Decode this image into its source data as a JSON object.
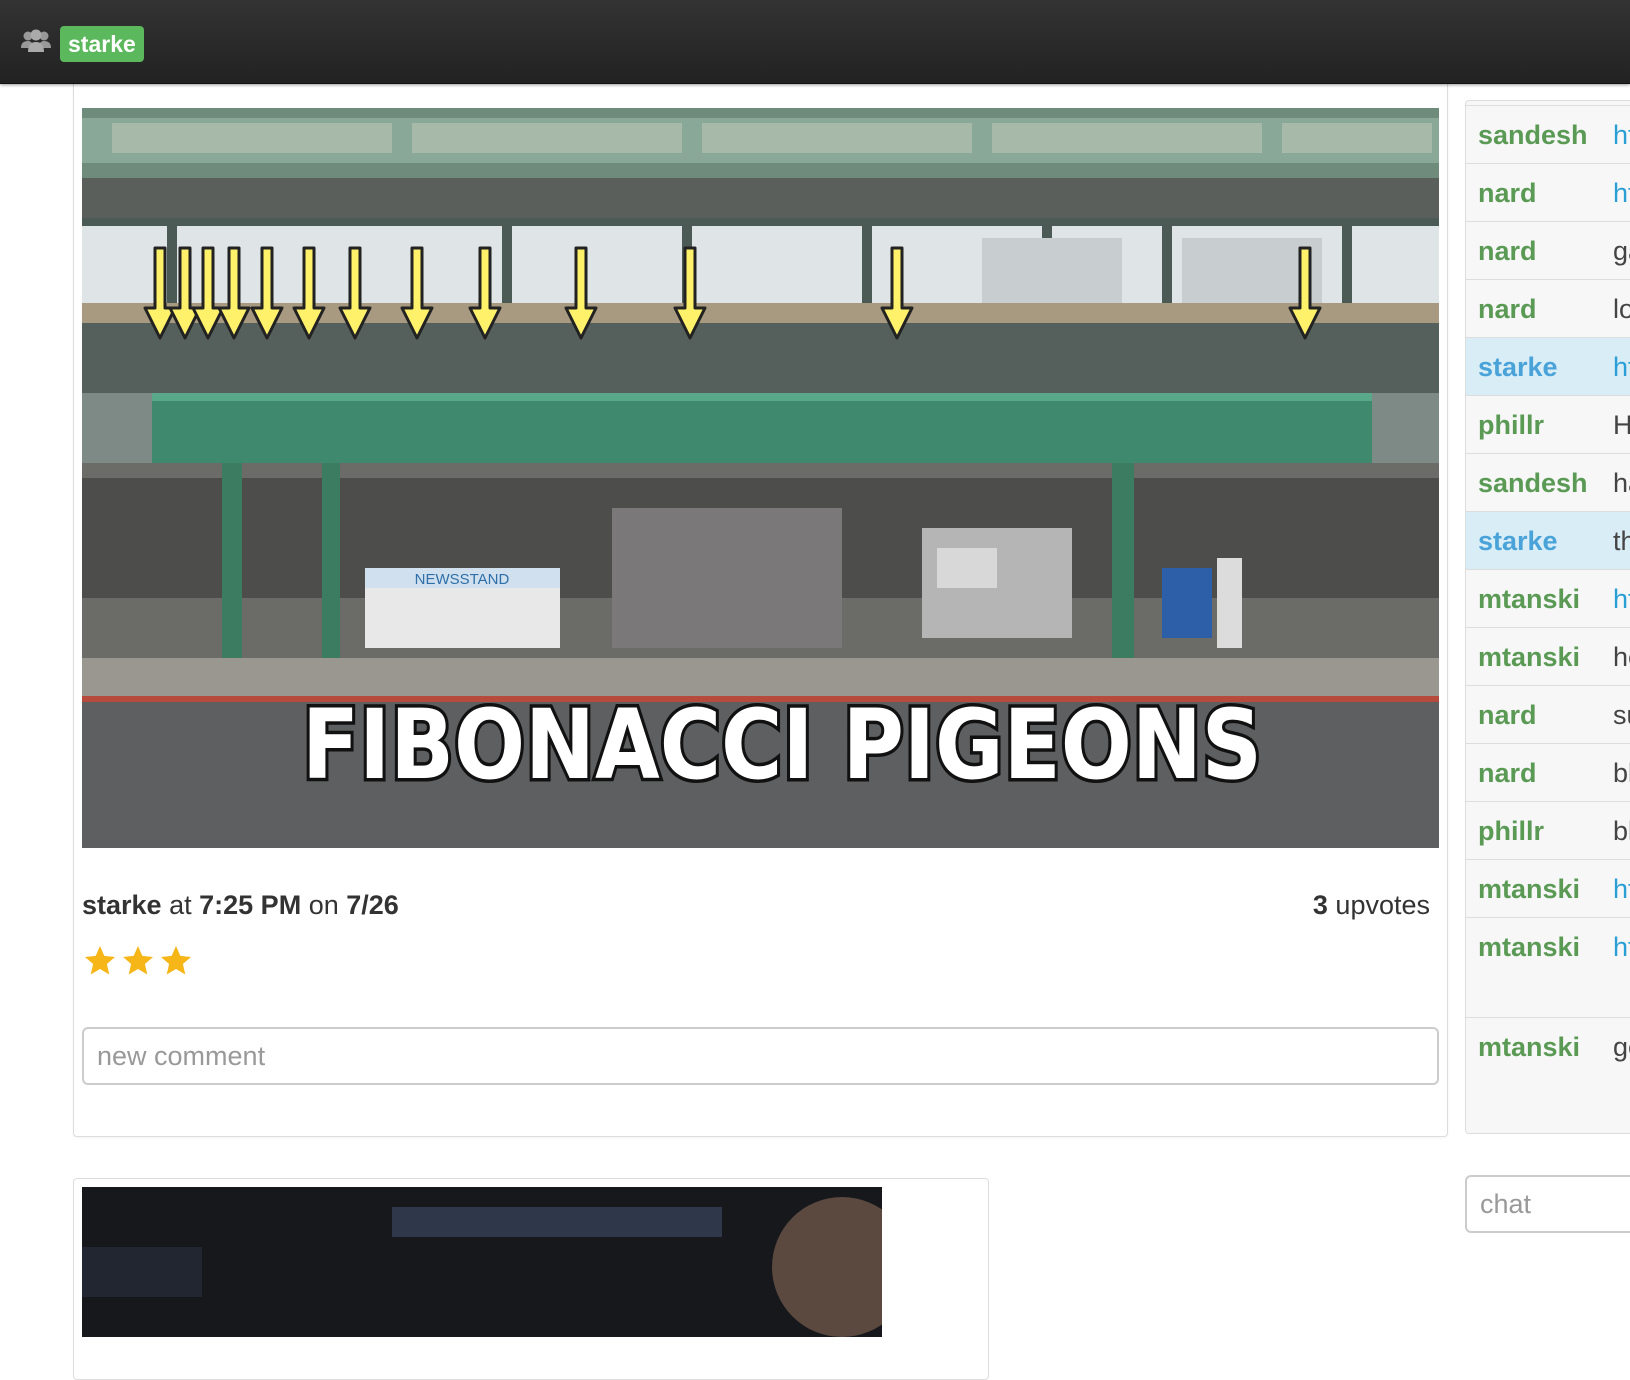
{
  "topbar": {
    "icon": "users-icon",
    "username": "starke"
  },
  "post1": {
    "image_caption": "FIBONACCI PIGEONS",
    "image_sign": "NEWSSTAND",
    "author": "starke",
    "at_word": "at",
    "time": "7:25 PM",
    "on_word": "on",
    "date": "7/26",
    "upvote_count": "3",
    "upvote_label": "upvotes",
    "rating": 3,
    "comment_placeholder": "new comment"
  },
  "chat": {
    "rows": [
      {
        "user": "sandesh",
        "msg": "ht",
        "link": true,
        "me": false
      },
      {
        "user": "nard",
        "msg": "ht",
        "link": true,
        "me": false
      },
      {
        "user": "nard",
        "msg": "ga",
        "link": false,
        "me": false
      },
      {
        "user": "nard",
        "msg": "lo",
        "link": false,
        "me": false
      },
      {
        "user": "starke",
        "msg": "ht",
        "link": true,
        "me": true
      },
      {
        "user": "phillr",
        "msg": "H",
        "link": false,
        "me": false
      },
      {
        "user": "sandesh",
        "msg": "ha",
        "link": false,
        "me": false
      },
      {
        "user": "starke",
        "msg": "th",
        "link": false,
        "me": true
      },
      {
        "user": "mtanski",
        "msg": "ht",
        "link": true,
        "me": false
      },
      {
        "user": "mtanski",
        "msg": "he",
        "link": false,
        "me": false
      },
      {
        "user": "nard",
        "msg": "su",
        "link": false,
        "me": false
      },
      {
        "user": "nard",
        "msg": "bl",
        "link": false,
        "me": false
      },
      {
        "user": "phillr",
        "msg": "bl",
        "link": false,
        "me": false
      },
      {
        "user": "mtanski",
        "msg": "ht",
        "link": true,
        "me": false
      },
      {
        "user": "mtanski",
        "msg": "ht",
        "link": true,
        "me": false
      },
      {
        "user": "mtanski",
        "msg": "ge",
        "link": false,
        "me": false
      }
    ],
    "input_placeholder": "chat"
  },
  "colors": {
    "topbar": "#222222",
    "badge": "#5cb85c",
    "username_green": "#5a9a55",
    "username_blue": "#4aa3d8",
    "link": "#2a9fd6",
    "star": "#f6b618"
  }
}
